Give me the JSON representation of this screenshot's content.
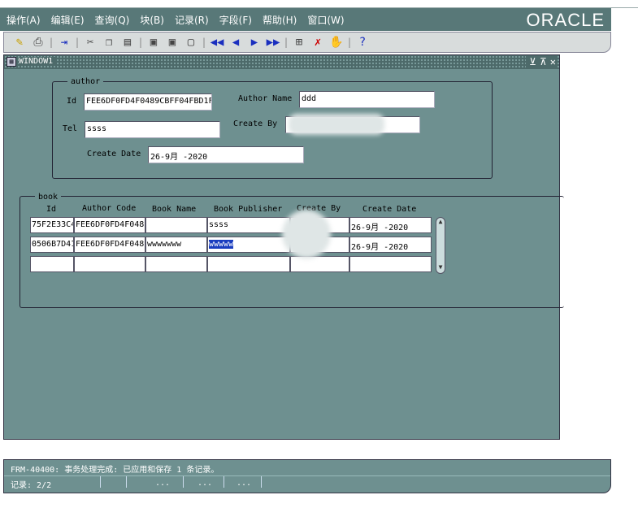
{
  "menu": [
    "操作(A)",
    "编辑(E)",
    "查询(Q)",
    "块(B)",
    "记录(R)",
    "字段(F)",
    "帮助(H)",
    "窗口(W)"
  ],
  "brand": "ORACLE",
  "toolbar_icons": [
    "save-icon",
    "print-icon",
    "exit-icon",
    "cut-icon",
    "copy-icon",
    "paste-icon",
    "enter-query-icon",
    "execute-query-icon",
    "cancel-query-icon",
    "first-record-icon",
    "previous-record-icon",
    "next-record-icon",
    "last-record-icon",
    "insert-record-icon",
    "delete-record-icon",
    "lock-record-icon",
    "help-icon"
  ],
  "window": {
    "title": "WINDOW1"
  },
  "author": {
    "frame_title": "author",
    "id_label": "Id",
    "id_value": "FEE6DF0FD4F0489CBFF04FBD1F",
    "name_label": "Author Name",
    "name_value": "ddd",
    "tel_label": "Tel",
    "tel_value": "ssss",
    "create_by_label": "Create By",
    "create_by_value": "",
    "create_date_label": "Create Date",
    "create_date_value": "26-9月 -2020"
  },
  "book": {
    "frame_title": "book",
    "headers": [
      "Id",
      "Author Code",
      "Book Name",
      "Book Publisher",
      "Create By",
      "Create Date"
    ],
    "rows": [
      [
        "75F2E33C4",
        "FEE6DF0FD4F048!",
        "",
        "ssss",
        "",
        "26-9月 -2020"
      ],
      [
        "0506B7D41",
        "FEE6DF0FD4F048!",
        "wwwwwww",
        "wwwww",
        "",
        "26-9月 -2020"
      ],
      [
        "",
        "",
        "",
        "",
        "",
        ""
      ]
    ]
  },
  "status": {
    "message": "FRM-40400: 事务处理完成: 已应用和保存 1 条记录。",
    "record": "记录: 2/2",
    "dots": [
      "...",
      "...",
      "..."
    ]
  },
  "colors": {
    "window_bg": "#6e9090",
    "menu_bg": "#587878",
    "selection": "#1a3dbf"
  }
}
